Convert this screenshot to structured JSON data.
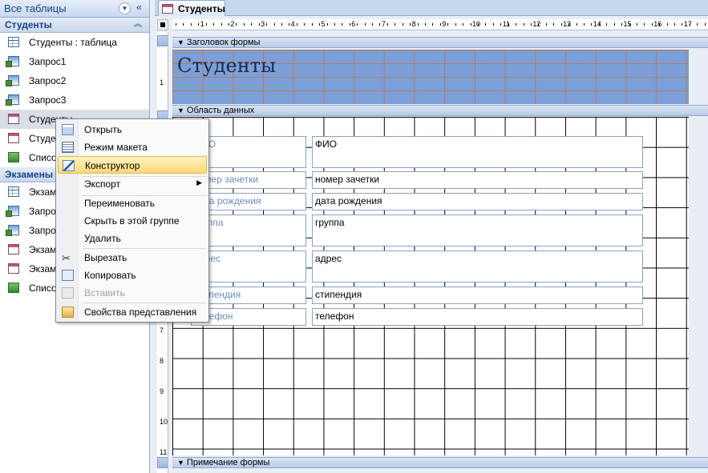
{
  "nav": {
    "header": "Все таблицы",
    "groups": [
      {
        "label": "Студенты",
        "items": [
          {
            "label": "Студенты : таблица",
            "icon": "table-icon"
          },
          {
            "label": "Запрос1",
            "icon": "query-icon"
          },
          {
            "label": "Запрос2",
            "icon": "query-icon"
          },
          {
            "label": "Запрос3",
            "icon": "query-icon"
          },
          {
            "label": "Студенты",
            "icon": "form-icon"
          },
          {
            "label": "Студенты",
            "icon": "form-icon"
          },
          {
            "label": "Список",
            "icon": "report-icon"
          }
        ]
      },
      {
        "label": "Экзамены",
        "items": [
          {
            "label": "Экзам",
            "icon": "table-icon"
          },
          {
            "label": "Запро",
            "icon": "query-icon"
          },
          {
            "label": "Запро",
            "icon": "query-icon"
          },
          {
            "label": "Экзам",
            "icon": "form-icon"
          },
          {
            "label": "Экзам",
            "icon": "form-icon"
          },
          {
            "label": "Списо",
            "icon": "report-icon"
          }
        ]
      }
    ]
  },
  "tab": {
    "label": "Студенты"
  },
  "ruler": {
    "h_numbers": [
      "1",
      "2",
      "3",
      "4",
      "5",
      "6",
      "7",
      "8",
      "9",
      "10",
      "11",
      "12",
      "13",
      "14",
      "15",
      "16",
      "17"
    ],
    "v_numbers": [
      "1",
      "7",
      "8",
      "9",
      "10",
      "11"
    ]
  },
  "sections": {
    "header": "Заголовок формы",
    "detail": "Область данных",
    "footer": "Примечание формы"
  },
  "form_title": "Студенты",
  "fields": [
    {
      "label": "ФИО",
      "value": "ФИО"
    },
    {
      "label": "номер зачетки",
      "value": "номер зачетки"
    },
    {
      "label": "дата рождения",
      "value": "дата рождения"
    },
    {
      "label": "группа",
      "value": "группа"
    },
    {
      "label": "адрес",
      "value": "адрес"
    },
    {
      "label": "стипендия",
      "value": "стипендия"
    },
    {
      "label": "телефон",
      "value": "телефон"
    }
  ],
  "context_menu": {
    "items": [
      {
        "label": "Открыть",
        "icon": "open-icon"
      },
      {
        "label": "Режим макета",
        "icon": "layout-view-icon"
      },
      {
        "label": "Конструктор",
        "icon": "design-view-icon",
        "highlighted": true
      },
      {
        "label": "Экспорт",
        "icon": "",
        "submenu": true
      },
      {
        "label": "Переименовать",
        "icon": ""
      },
      {
        "label": "Скрыть в этой группе",
        "icon": ""
      },
      {
        "label": "Удалить",
        "icon": ""
      },
      {
        "label": "Вырезать",
        "icon": "cut-icon"
      },
      {
        "label": "Копировать",
        "icon": "copy-icon"
      },
      {
        "label": "Вставить",
        "icon": "paste-icon",
        "disabled": true
      },
      {
        "label": "Свойства представления",
        "icon": "properties-icon"
      }
    ]
  }
}
